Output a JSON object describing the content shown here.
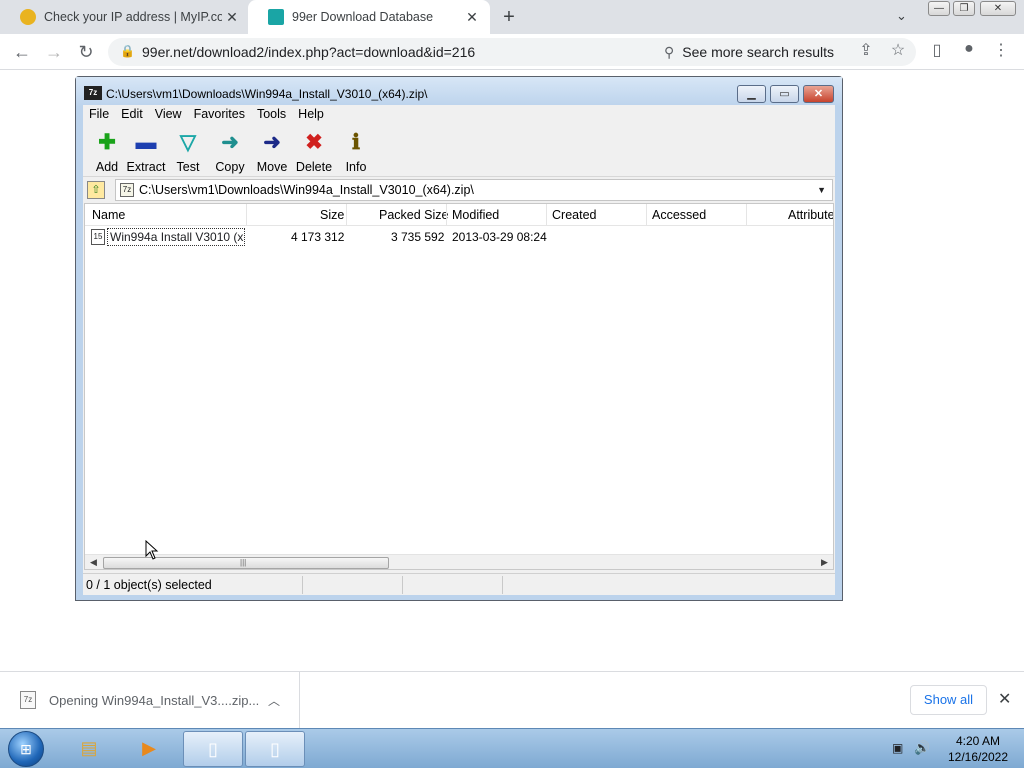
{
  "browser": {
    "tabs": [
      {
        "title": "Check your IP address | MyIP.com",
        "active": false
      },
      {
        "title": "99er Download Database",
        "active": true
      }
    ],
    "new_tab_label": "+",
    "url": "99er.net/download2/index.php?act=download&id=216",
    "search_more_label": "See more search results"
  },
  "sevenzip": {
    "title": "C:\\Users\\vm1\\Downloads\\Win994a_Install_V3010_(x64).zip\\",
    "app_icon_text": "7z",
    "menu": [
      "File",
      "Edit",
      "View",
      "Favorites",
      "Tools",
      "Help"
    ],
    "tools": [
      {
        "label": "Add",
        "icon": "add-icon",
        "glyph": "✚",
        "color": "#1aa31a"
      },
      {
        "label": "Extract",
        "icon": "extract-icon",
        "glyph": "▬",
        "color": "#1d3fb0"
      },
      {
        "label": "Test",
        "icon": "test-icon",
        "glyph": "▽",
        "color": "#1ca7a7"
      },
      {
        "label": "Copy",
        "icon": "copy-icon",
        "glyph": "➜",
        "color": "#1f8f8f"
      },
      {
        "label": "Move",
        "icon": "move-icon",
        "glyph": "➜",
        "color": "#1c2a88"
      },
      {
        "label": "Delete",
        "icon": "delete-icon",
        "glyph": "✖",
        "color": "#d0201e"
      },
      {
        "label": "Info",
        "icon": "info-icon",
        "glyph": "ℹ",
        "color": "#6b5400"
      }
    ],
    "path": "C:\\Users\\vm1\\Downloads\\Win994a_Install_V3010_(x64).zip\\",
    "columns": [
      "Name",
      "Size",
      "Packed Size",
      "Modified",
      "Created",
      "Accessed",
      "Attribute"
    ],
    "rows": [
      {
        "name": "Win994a Install V3010 (x...",
        "size": "4 173 312",
        "packed": "3 735 592",
        "modified": "2013-03-29 08:24",
        "created": "",
        "accessed": "",
        "attributes": ""
      }
    ],
    "status": "0 / 1 object(s) selected"
  },
  "downloads": {
    "item_text": "Opening Win994a_Install_V3....zip...",
    "show_all_label": "Show all"
  },
  "taskbar": {
    "time": "4:20 AM",
    "date": "12/16/2022"
  }
}
